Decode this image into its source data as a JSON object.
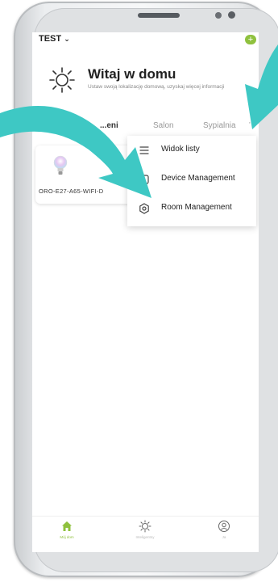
{
  "header": {
    "home_name": "TEST",
    "home_caret": "⌄",
    "add_glyph": "+"
  },
  "welcome": {
    "title": "Witaj w domu",
    "subtitle": "Ustaw swoją lokalizację domową, uzyskaj więcej informacji"
  },
  "tabs": [
    {
      "label": "...eni"
    },
    {
      "label": "Salon"
    },
    {
      "label": "Sypialnia"
    }
  ],
  "tabs_more": "···",
  "device": {
    "name": "ORO-E27-A65-WIFI-D"
  },
  "menu": {
    "items": [
      {
        "label": "Widok listy",
        "icon": "list-icon"
      },
      {
        "label": "Device Management",
        "icon": "device-management-icon"
      },
      {
        "label": "Room Management",
        "icon": "settings-gear-icon"
      }
    ]
  },
  "bottom_nav": {
    "items": [
      {
        "label": "Mój dom",
        "icon": "home-icon",
        "active": true
      },
      {
        "label": "Inteligentny",
        "icon": "sun-icon",
        "active": false
      },
      {
        "label": "Ja",
        "icon": "profile-icon",
        "active": false
      }
    ]
  },
  "colors": {
    "accent": "#8fc13e",
    "arrow": "#3ec8c4"
  }
}
